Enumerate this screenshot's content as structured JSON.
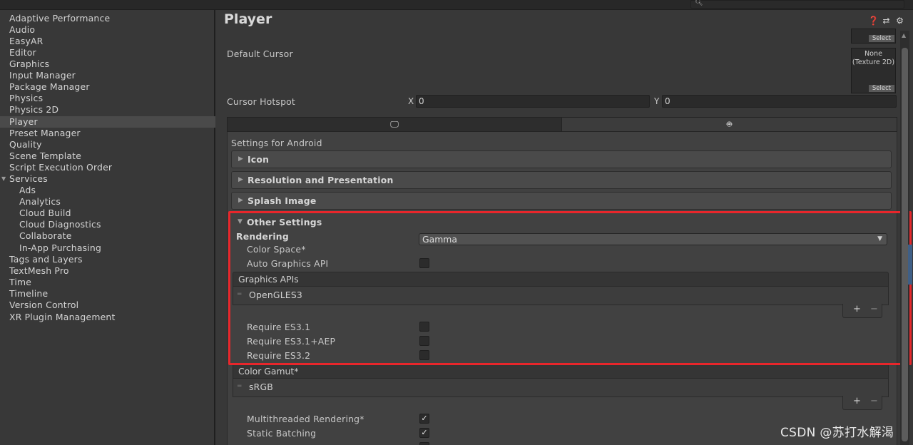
{
  "sidebar": {
    "items": [
      {
        "label": "Adaptive Performance"
      },
      {
        "label": "Audio"
      },
      {
        "label": "EasyAR"
      },
      {
        "label": "Editor"
      },
      {
        "label": "Graphics"
      },
      {
        "label": "Input Manager"
      },
      {
        "label": "Package Manager"
      },
      {
        "label": "Physics"
      },
      {
        "label": "Physics 2D"
      },
      {
        "label": "Player"
      },
      {
        "label": "Preset Manager"
      },
      {
        "label": "Quality"
      },
      {
        "label": "Scene Template"
      },
      {
        "label": "Script Execution Order"
      },
      {
        "label": "Services"
      },
      {
        "label": "Ads"
      },
      {
        "label": "Analytics"
      },
      {
        "label": "Cloud Build"
      },
      {
        "label": "Cloud Diagnostics"
      },
      {
        "label": "Collaborate"
      },
      {
        "label": "In-App Purchasing"
      },
      {
        "label": "Tags and Layers"
      },
      {
        "label": "TextMesh Pro"
      },
      {
        "label": "Time"
      },
      {
        "label": "Timeline"
      },
      {
        "label": "Version Control"
      },
      {
        "label": "XR Plugin Management"
      }
    ],
    "selected": "Player"
  },
  "header": {
    "title": "Player",
    "icons": [
      "help-icon",
      "preset-icon",
      "settings-gear-icon"
    ]
  },
  "cursor": {
    "default_cursor_label": "Default Cursor",
    "texture_select_label": "Select",
    "texture_value": "None\n(Texture 2D)",
    "hotspot_label": "Cursor Hotspot",
    "x_label": "X",
    "x_value": "0",
    "y_label": "Y",
    "y_value": "0"
  },
  "platform_tabs": [
    "desktop-monitor-icon",
    "android-icon"
  ],
  "settings_for": "Settings for Android",
  "sections": {
    "icon": "Icon",
    "resolution": "Resolution and Presentation",
    "splash": "Splash Image",
    "other": "Other Settings"
  },
  "rendering": {
    "heading": "Rendering",
    "color_space_label": "Color Space*",
    "color_space_value": "Gamma",
    "auto_graphics_label": "Auto Graphics API",
    "auto_graphics_checked": false,
    "graphics_apis_header": "Graphics APIs",
    "graphics_apis": [
      "OpenGLES3"
    ],
    "require_es31_label": "Require ES3.1",
    "require_es31_aep_label": "Require ES3.1+AEP",
    "require_es32_label": "Require ES3.2",
    "color_gamut_header": "Color Gamut*",
    "color_gamut": [
      "sRGB"
    ],
    "multithreaded_label": "Multithreaded Rendering*",
    "multithreaded_checked": true,
    "static_batching_label": "Static Batching",
    "static_batching_checked": true,
    "plus": "+",
    "minus": "−",
    "check_mark": "✓"
  },
  "watermark": "CSDN @苏打水解渴",
  "colors": {
    "highlight": "#e8262b",
    "background": "#383838"
  }
}
